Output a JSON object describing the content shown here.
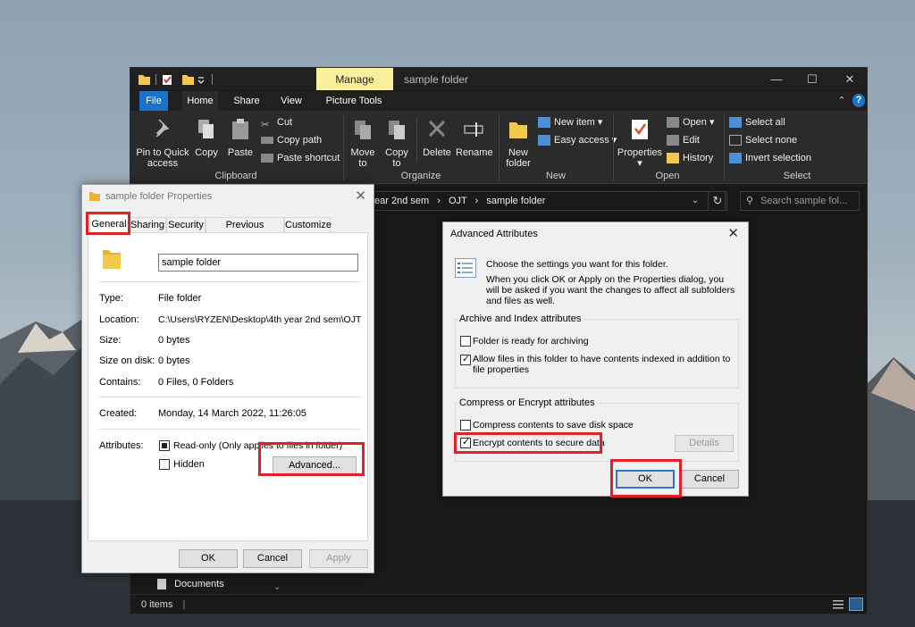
{
  "explorer": {
    "title": "sample folder",
    "manage_tab": "Manage",
    "tabs": [
      "File",
      "Home",
      "Share",
      "View",
      "Picture Tools"
    ],
    "ribbon": {
      "clipboard": {
        "pin": [
          "Pin to Quick",
          "access"
        ],
        "copy": "Copy",
        "paste": "Paste",
        "cut": "Cut",
        "copy_path": "Copy path",
        "paste_shortcut": "Paste shortcut",
        "label": "Clipboard"
      },
      "organize": {
        "move_to": [
          "Move",
          "to"
        ],
        "copy_to": [
          "Copy",
          "to"
        ],
        "delete": "Delete",
        "rename": "Rename",
        "label": "Organize"
      },
      "new": {
        "new_item": "New item",
        "easy_access": "Easy access",
        "new_folder": [
          "New",
          "folder"
        ],
        "label": "New"
      },
      "open": {
        "properties": "Properties",
        "open": "Open",
        "edit": "Edit",
        "history": "History",
        "label": "Open"
      },
      "select": {
        "select_all": "Select all",
        "select_none": "Select none",
        "invert": "Invert selection",
        "label": "Select"
      }
    },
    "address": {
      "crumb1": "ear 2nd sem",
      "crumb2": "OJT",
      "crumb3": "sample folder"
    },
    "search_placeholder": "Search sample fol...",
    "nav_documents": "Documents",
    "status_items": "0 items"
  },
  "properties_dialog": {
    "title": "sample folder Properties",
    "tabs": [
      "General",
      "Sharing",
      "Security",
      "Previous Versions",
      "Customize"
    ],
    "name": "sample folder",
    "fields": {
      "type_label": "Type:",
      "type_value": "File folder",
      "location_label": "Location:",
      "location_value": "C:\\Users\\RYZEN\\Desktop\\4th year 2nd sem\\OJT",
      "size_label": "Size:",
      "size_value": "0 bytes",
      "size_on_disk_label": "Size on disk:",
      "size_on_disk_value": "0 bytes",
      "contains_label": "Contains:",
      "contains_value": "0 Files, 0 Folders",
      "created_label": "Created:",
      "created_value": "Monday, 14 March 2022, 11:26:05",
      "attributes_label": "Attributes:"
    },
    "readonly": "Read-only (Only applies to files in folder)",
    "hidden": "Hidden",
    "advanced": "Advanced...",
    "ok": "OK",
    "cancel": "Cancel",
    "apply": "Apply"
  },
  "advanced_dialog": {
    "title": "Advanced Attributes",
    "intro": "Choose the settings you want for this folder.",
    "intro2": "When you click OK or Apply on the Properties dialog, you will be asked if you want the changes to affect all subfolders and files as well.",
    "archive_group": "Archive and Index attributes",
    "archiving": "Folder is ready for archiving",
    "indexing": "Allow files in this folder to have contents indexed in addition to file properties",
    "compress_group": "Compress or Encrypt attributes",
    "compress": "Compress contents to save disk space",
    "encrypt": "Encrypt contents to secure data",
    "details": "Details",
    "ok": "OK",
    "cancel": "Cancel"
  },
  "colors": {
    "highlight": "#e0202a",
    "file_tab": "#1a73c9",
    "manage_tab": "#f9ef9d"
  }
}
